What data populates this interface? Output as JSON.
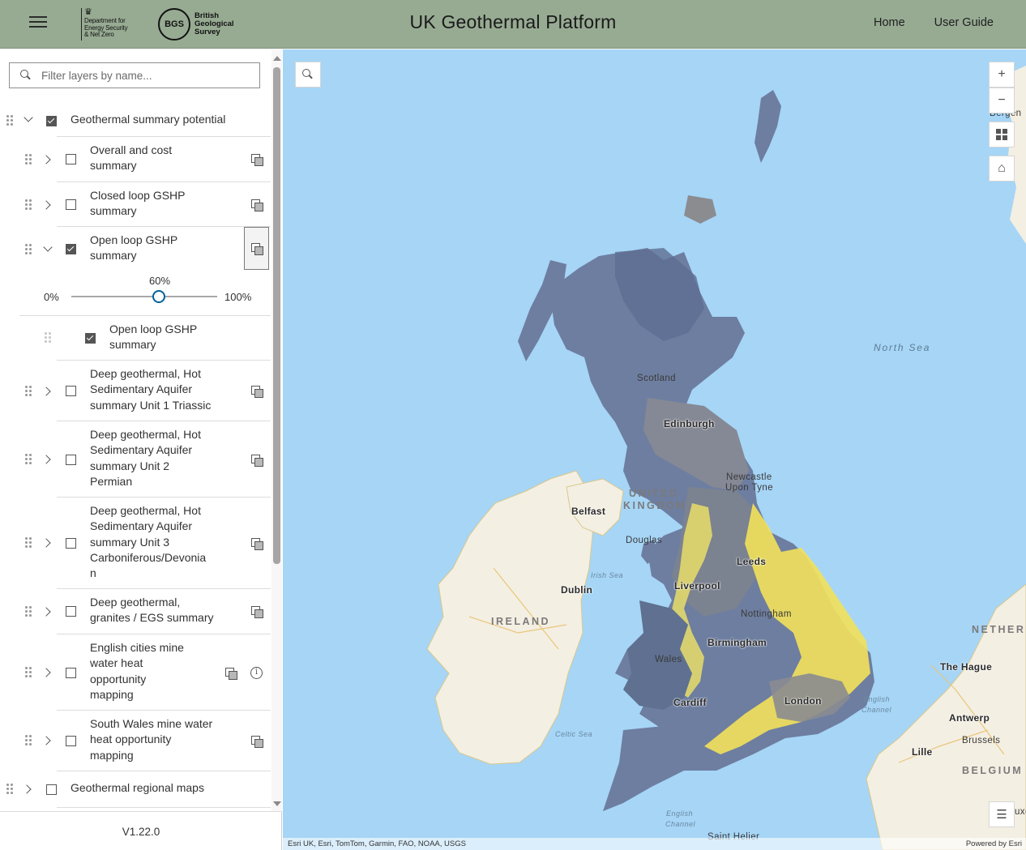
{
  "header": {
    "menu_icon": "hamburger-menu-icon",
    "desnz_logo_lines": [
      "Department for",
      "Energy Security",
      "& Net Zero"
    ],
    "bgs_logo_mark": "BGS",
    "bgs_logo_lines": [
      "British",
      "Geological",
      "Survey"
    ],
    "title": "UK Geothermal Platform",
    "nav": [
      {
        "label": "Home"
      },
      {
        "label": "User Guide"
      }
    ],
    "background_color": "#97ab93"
  },
  "sidebar": {
    "search": {
      "placeholder": "Filter layers by name...",
      "value": ""
    },
    "groups": [
      {
        "label": "Geothermal summary potential",
        "expanded": true,
        "checked": true,
        "layers": [
          {
            "label_lines": [
              "Overall and cost",
              "summary"
            ],
            "checked": false,
            "expanded": false
          },
          {
            "label_lines": [
              "Closed loop GSHP",
              "summary"
            ],
            "checked": false,
            "expanded": false
          },
          {
            "label_lines": [
              "Open loop GSHP",
              "summary"
            ],
            "checked": true,
            "expanded": true,
            "opacity": {
              "value_label": "60%",
              "value": 0.6,
              "min_label": "0%",
              "max_label": "100%"
            },
            "sublayers": [
              {
                "label_lines": [
                  "Open loop GSHP",
                  "summary"
                ],
                "checked": true
              }
            ]
          },
          {
            "label_lines": [
              "Deep geothermal, Hot",
              "Sedimentary Aquifer",
              "summary Unit 1 Triassic"
            ],
            "checked": false,
            "expanded": false
          },
          {
            "label_lines": [
              "Deep geothermal, Hot",
              "Sedimentary Aquifer",
              "summary Unit 2",
              "Permian"
            ],
            "checked": false,
            "expanded": false
          },
          {
            "label_lines": [
              "Deep geothermal, Hot",
              "Sedimentary Aquifer",
              "summary Unit 3",
              "Carboniferous/Devonia",
              "n"
            ],
            "checked": false,
            "expanded": false
          },
          {
            "label_lines": [
              "Deep geothermal,",
              "granites / EGS summary"
            ],
            "checked": false,
            "expanded": false
          },
          {
            "label_lines": [
              "English cities mine",
              "water heat",
              "opportunity",
              "mapping"
            ],
            "checked": false,
            "expanded": false,
            "has_info": true
          },
          {
            "label_lines": [
              "South Wales mine water",
              "heat opportunity",
              "mapping"
            ],
            "checked": false,
            "expanded": false
          }
        ]
      },
      {
        "label": "Geothermal regional maps",
        "expanded": false,
        "checked": false
      }
    ],
    "version": "V1.22.0"
  },
  "map": {
    "controls": {
      "search_icon": "search-icon",
      "zoom_in": "+",
      "zoom_out": "−",
      "basemap_icon": "basemap-gallery-icon",
      "home_icon": "home-icon",
      "legend_icon": "legend-list-icon"
    },
    "labels": {
      "scotland": "Scotland",
      "edinburgh": "Edinburgh",
      "newcastle_1": "Newcastle",
      "newcastle_2": "Upon Tyne",
      "united": "UNITED",
      "kingdom": "KINGDOM",
      "belfast": "Belfast",
      "douglas": "Douglas",
      "leeds": "Leeds",
      "liverpool": "Liverpool",
      "dublin": "Dublin",
      "ireland": "IRELAND",
      "irish_sea": "Irish Sea",
      "nottingham": "Nottingham",
      "birmingham": "Birmingham",
      "wales": "Wales",
      "cardiff": "Cardiff",
      "london": "London",
      "north_sea": "North Sea",
      "english_channel_1": "English",
      "english_channel_2": "Channel",
      "english_channel_sw_1": "English",
      "english_channel_sw_2": "Channel",
      "celtic_sea": "Celtic Sea",
      "the_hague": "The Hague",
      "antwerp": "Antwerp",
      "brussels": "Brussels",
      "lille": "Lille",
      "belgium": "BELGIUM",
      "nether": "NETHER",
      "bergen": "Bergen",
      "saint_helier": "Saint Helier",
      "uxe": "uxe"
    },
    "attribution": "Esri UK, Esri, TomTom, Garmin, FAO, NOAA, USGS",
    "powered_by": "Powered by Esri",
    "colors": {
      "sea": "#a6d5f6",
      "land": "#f4efe3",
      "summary_blue": "#6e7ea0",
      "summary_grey": "#8a8c90",
      "summary_yellow": "#f2e15a",
      "summary_olive": "#6e8070"
    }
  }
}
